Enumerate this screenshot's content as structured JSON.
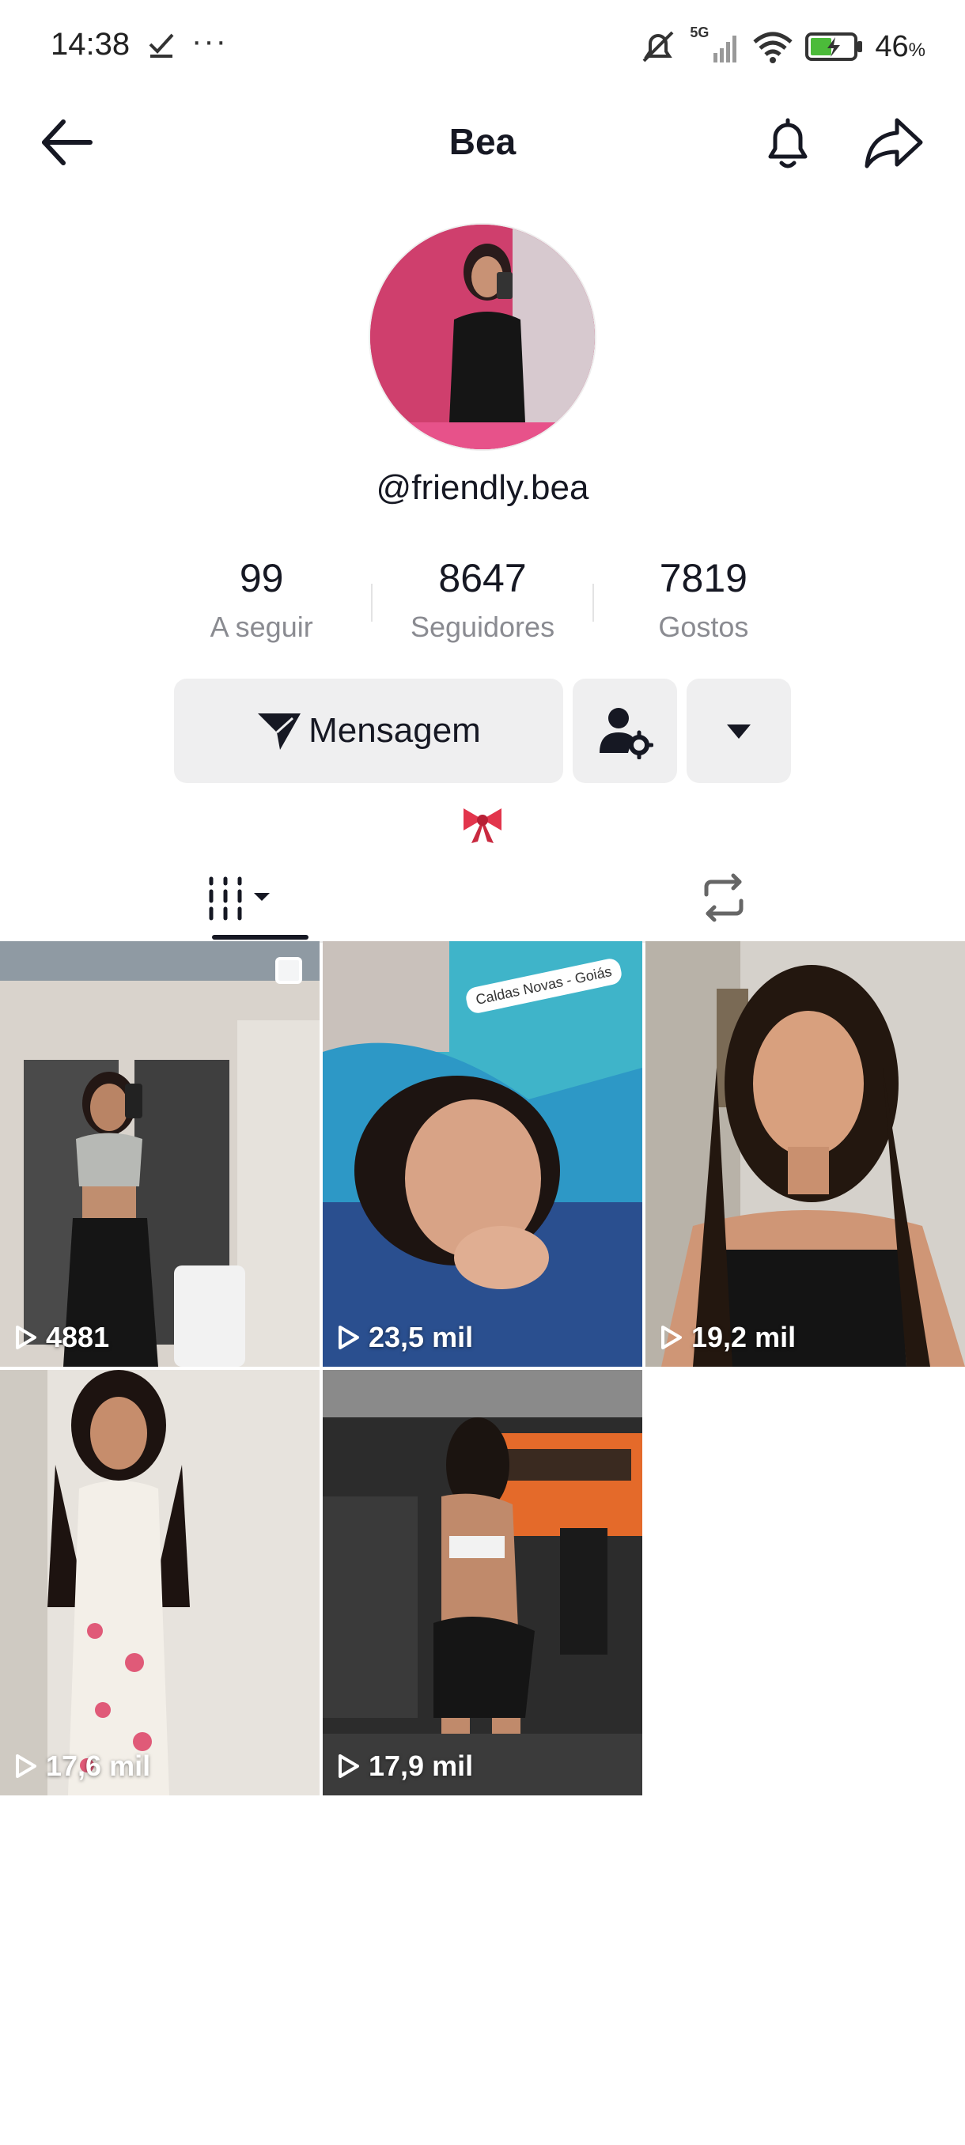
{
  "status_bar": {
    "time": "14:38",
    "network": "5G",
    "battery_percent": "46",
    "battery_unit": "%"
  },
  "header": {
    "title": "Bea"
  },
  "profile": {
    "username": "@friendly.bea",
    "stats": [
      {
        "value": "99",
        "label": "A seguir"
      },
      {
        "value": "8647",
        "label": "Seguidores"
      },
      {
        "value": "7819",
        "label": "Gostos"
      }
    ],
    "message_button": "Mensagem",
    "bio_emoji": "🎀"
  },
  "videos": [
    {
      "views": "4881",
      "pinned": true
    },
    {
      "views": "23,5 mil",
      "location": "Caldas Novas - Goiás"
    },
    {
      "views": "19,2 mil"
    },
    {
      "views": "17,6 mil"
    },
    {
      "views": "17,9 mil"
    }
  ],
  "colors": {
    "text": "#161823",
    "secondary_text": "#8a8b91",
    "button_bg": "#efeff0"
  }
}
